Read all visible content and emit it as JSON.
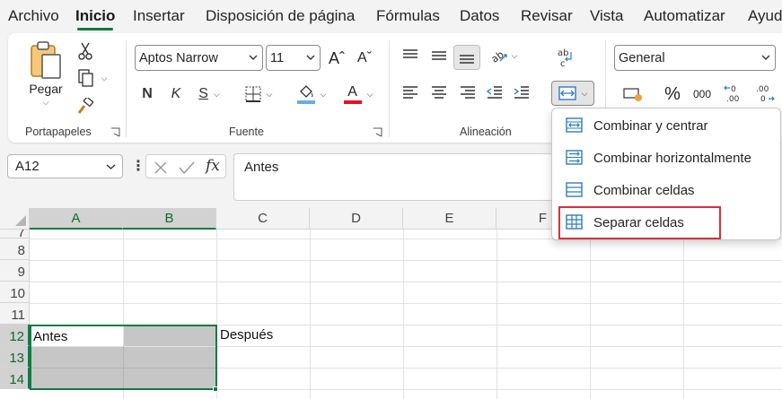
{
  "menu": {
    "tabs": [
      "Archivo",
      "Inicio",
      "Insertar",
      "Disposición de página",
      "Fórmulas",
      "Datos",
      "Revisar",
      "Vista",
      "Automatizar",
      "Ayuda"
    ],
    "active": "Inicio"
  },
  "ribbon": {
    "clipboard": {
      "paste_label": "Pegar",
      "group_label": "Portapapeles"
    },
    "font": {
      "name": "Aptos Narrow",
      "size": "11",
      "bold": "N",
      "italic": "K",
      "underline": "S",
      "font_color": "A",
      "group_label": "Fuente"
    },
    "alignment": {
      "group_label": "Alineación",
      "wrap_glyph": "ab c"
    },
    "number": {
      "format": "General",
      "percent": "%",
      "thousands": "000",
      "dec_inc": "←0 .00",
      "dec_dec": ".00 →0"
    }
  },
  "formula_bar": {
    "name_box": "A12",
    "fx": "fx",
    "content": "Antes"
  },
  "grid": {
    "columns": [
      "A",
      "B",
      "C",
      "D",
      "E",
      "F"
    ],
    "rows": [
      "7",
      "8",
      "9",
      "10",
      "11",
      "12",
      "13",
      "14"
    ],
    "cells": {
      "A12": "Antes",
      "C12": "Después"
    }
  },
  "merge_menu": {
    "items": [
      {
        "label": "Combinar y centrar",
        "icon": "merge-center-icon"
      },
      {
        "label": "Combinar horizontalmente",
        "icon": "merge-across-icon"
      },
      {
        "label": "Combinar celdas",
        "icon": "merge-cells-icon"
      },
      {
        "label": "Separar celdas",
        "icon": "unmerge-cells-icon",
        "highlighted": true
      }
    ],
    "highlight_color": "#d13438"
  },
  "colors": {
    "accent": "#107c41",
    "fill_bar": "#5fb2e5",
    "font_color_bar": "#e81123",
    "selection_fill": "#c6c6c6"
  }
}
